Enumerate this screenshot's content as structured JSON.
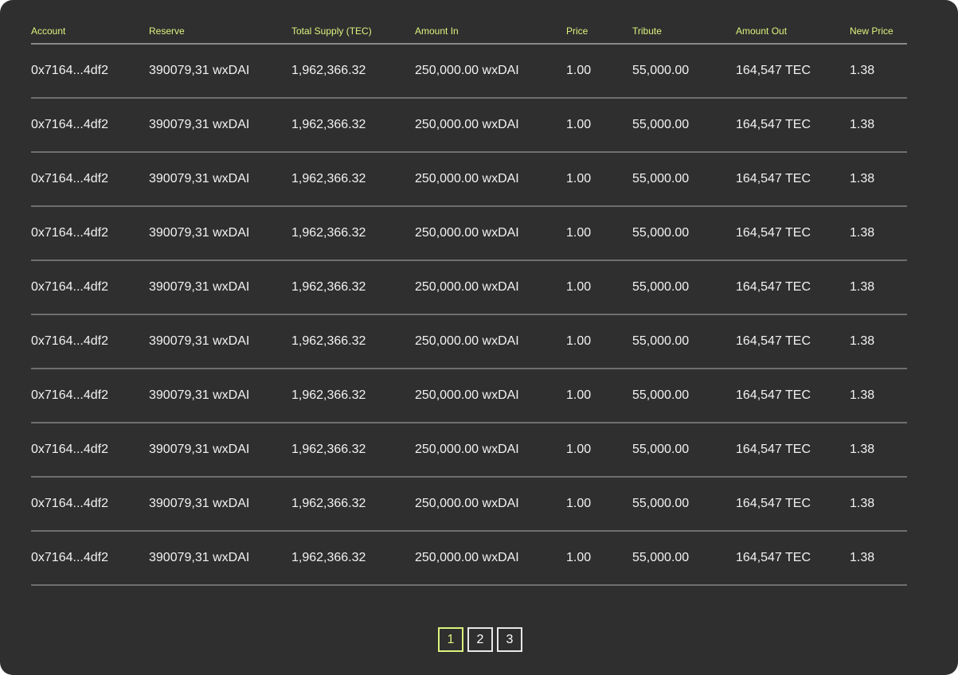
{
  "table": {
    "columns": [
      "Account",
      "Reserve",
      "Total Supply (TEC)",
      "Amount In",
      "Price",
      "Tribute",
      "Amount Out",
      "New Price"
    ],
    "rows": [
      [
        "0x7164...4df2",
        "390079,31 wxDAI",
        "1,962,366.32",
        "250,000.00 wxDAI",
        "1.00",
        "55,000.00",
        "164,547 TEC",
        "1.38"
      ],
      [
        "0x7164...4df2",
        "390079,31 wxDAI",
        "1,962,366.32",
        "250,000.00 wxDAI",
        "1.00",
        "55,000.00",
        "164,547 TEC",
        "1.38"
      ],
      [
        "0x7164...4df2",
        "390079,31 wxDAI",
        "1,962,366.32",
        "250,000.00 wxDAI",
        "1.00",
        "55,000.00",
        "164,547 TEC",
        "1.38"
      ],
      [
        "0x7164...4df2",
        "390079,31 wxDAI",
        "1,962,366.32",
        "250,000.00 wxDAI",
        "1.00",
        "55,000.00",
        "164,547 TEC",
        "1.38"
      ],
      [
        "0x7164...4df2",
        "390079,31 wxDAI",
        "1,962,366.32",
        "250,000.00 wxDAI",
        "1.00",
        "55,000.00",
        "164,547 TEC",
        "1.38"
      ],
      [
        "0x7164...4df2",
        "390079,31 wxDAI",
        "1,962,366.32",
        "250,000.00 wxDAI",
        "1.00",
        "55,000.00",
        "164,547 TEC",
        "1.38"
      ],
      [
        "0x7164...4df2",
        "390079,31 wxDAI",
        "1,962,366.32",
        "250,000.00 wxDAI",
        "1.00",
        "55,000.00",
        "164,547 TEC",
        "1.38"
      ],
      [
        "0x7164...4df2",
        "390079,31 wxDAI",
        "1,962,366.32",
        "250,000.00 wxDAI",
        "1.00",
        "55,000.00",
        "164,547 TEC",
        "1.38"
      ],
      [
        "0x7164...4df2",
        "390079,31 wxDAI",
        "1,962,366.32",
        "250,000.00 wxDAI",
        "1.00",
        "55,000.00",
        "164,547 TEC",
        "1.38"
      ],
      [
        "0x7164...4df2",
        "390079,31 wxDAI",
        "1,962,366.32",
        "250,000.00 wxDAI",
        "1.00",
        "55,000.00",
        "164,547 TEC",
        "1.38"
      ]
    ]
  },
  "pagination": {
    "pages": [
      "1",
      "2",
      "3"
    ],
    "current": "1"
  },
  "colors": {
    "background": "#2f2f2f",
    "accent": "#dbf37e",
    "text": "#f2f2f2",
    "divider": "#6f6f6f"
  }
}
